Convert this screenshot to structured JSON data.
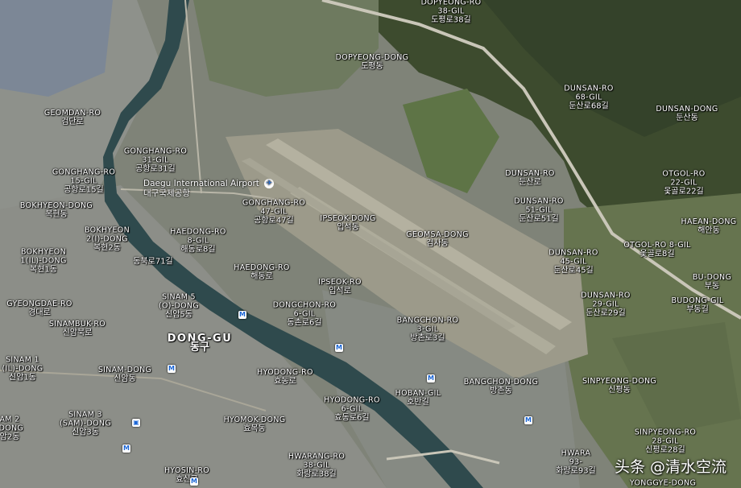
{
  "map": {
    "colors": {
      "urban": "#8a8d86",
      "river": "#2e4a4c",
      "forest": "#3b4a2c",
      "runway": "#9a9886",
      "field": "#6c7b55"
    },
    "airport": {
      "en": "Daegu International Airport",
      "ko": "대구국제공항",
      "icon": "airplane-icon"
    },
    "watermark": "头条 @清水空流",
    "labels": [
      {
        "id": "dopyeong-ro-38-gil",
        "en": "DOPYEONG-RO 38-GIL",
        "en1": "DOPYEONG-RO",
        "en2": "38-GIL",
        "ko": "도평로38길"
      },
      {
        "id": "dopyeong-dong",
        "en": "DOPYEONG-DONG",
        "ko": "도평동"
      },
      {
        "id": "geomdan-ro",
        "en": "GEOMDAN-RO",
        "ko": "검단로"
      },
      {
        "id": "dunsan-ro-68-gil",
        "en1": "DUNSAN-RO",
        "en2": "68-GIL",
        "ko": "둔산로68길"
      },
      {
        "id": "dunsan-dong",
        "en": "DUNSAN-DONG",
        "ko": "둔산동"
      },
      {
        "id": "gonghang-ro-31-gil",
        "en1": "GONGHANG-RO",
        "en2": "31-GIL",
        "ko": "공항로31길"
      },
      {
        "id": "gonghang-ro-15-gil",
        "en1": "GONGHANG-RO",
        "en2": "15-GIL",
        "ko": "공항로15길"
      },
      {
        "id": "bokhyeon-dong",
        "en": "BOKHYEON-DONG",
        "ko": "복현동"
      },
      {
        "id": "gonghang-ro-47-gil",
        "en1": "GONGHANG-RO",
        "en2": "47-GIL",
        "ko": "공항로47길"
      },
      {
        "id": "dunsan-ro",
        "en": "DUNSAN-RO",
        "ko": "둔산로"
      },
      {
        "id": "otgol-ro-22-gil",
        "en1": "OTGOL-RO",
        "en2": "22-GIL",
        "ko": "옻골로22길"
      },
      {
        "id": "dunsan-ro-51-gil",
        "en1": "DUNSAN-RO",
        "en2": "51-GIL",
        "ko": "둔산로51길"
      },
      {
        "id": "bokhyeon-2-dong",
        "en1": "BOKHYEON",
        "en2": "2(I)-DONG",
        "ko": "복현2동"
      },
      {
        "id": "haedong-ro-8-gil",
        "en1": "HAEDONG-RO",
        "en2": "8-GIL",
        "ko": "해동로8길"
      },
      {
        "id": "ipseok-dong",
        "en": "IPSEOK-DONG",
        "ko": "입석동"
      },
      {
        "id": "haean-dong",
        "en": "HAEAN-DONG",
        "ko": "해안동"
      },
      {
        "id": "geomsa-dong",
        "en": "GEOMSA-DONG",
        "ko": "검사동"
      },
      {
        "id": "otgol-ro-8-gil",
        "en": "OTGOL-RO 8-GIL",
        "ko": "옻골로8길"
      },
      {
        "id": "bokhyeon-1-dong",
        "en1": "BOKHYEON",
        "en2": "1(IL)-DONG",
        "ko": "복현1동"
      },
      {
        "id": "dongbungno-71-gil",
        "ko": "동북로71길"
      },
      {
        "id": "dunsan-ro-45-gil",
        "en1": "DUNSAN-RO",
        "en2": "45-GIL",
        "ko": "둔산로45길"
      },
      {
        "id": "haedong-ro",
        "en": "HAEDONG-RO",
        "ko": "해동로"
      },
      {
        "id": "bu-dong",
        "en": "BU-DONG",
        "ko": "부동"
      },
      {
        "id": "ipseok-ro",
        "en": "IPSEOK-RO",
        "ko": "입석로"
      },
      {
        "id": "gyeongdae-ro",
        "en": "GYEONGDAE-RO",
        "ko": "경대로"
      },
      {
        "id": "sinam-5-dong",
        "en1": "SINAM 5",
        "en2": "(O)-DONG",
        "ko": "신암5동"
      },
      {
        "id": "dongchon-ro-6-gil",
        "en1": "DONGCHON-RO",
        "en2": "6-GIL",
        "ko": "동촌로6길"
      },
      {
        "id": "dunsan-ro-29-gil",
        "en1": "DUNSAN-RO",
        "en2": "29-GIL",
        "ko": "둔산로29길"
      },
      {
        "id": "budong-gil",
        "en": "BUDONG-GIL",
        "ko": "부동길"
      },
      {
        "id": "sinambuk-ro",
        "en": "SINAMBUK-RO",
        "ko": "신암북로"
      },
      {
        "id": "bangchon-ro-3-gil",
        "en1": "BANGCHON-RO",
        "en2": "3-GIL",
        "ko": "방촌로3길"
      },
      {
        "id": "dong-gu",
        "en": "DONG-GU",
        "ko": "동구",
        "big": true
      },
      {
        "id": "sinam-1-dong",
        "en1": "SINAM 1",
        "en2": "(IL)-DONG",
        "ko": "신암1동"
      },
      {
        "id": "sinam-dong",
        "en": "SINAM-DONG",
        "ko": "신암동"
      },
      {
        "id": "hyodong-ro",
        "en": "HYODONG-RO",
        "ko": "효동로"
      },
      {
        "id": "sinpyeong-dong",
        "en": "SINPYEONG-DONG",
        "ko": "신평동"
      },
      {
        "id": "bangchon-dong",
        "en": "BANGCHON-DONG",
        "ko": "방촌동"
      },
      {
        "id": "hoban-gil",
        "en": "HOBAN-GIL",
        "ko": "호반길"
      },
      {
        "id": "hyodong-ro-6-gil",
        "en1": "HYODONG-RO",
        "en2": "6-GIL",
        "ko": "효동로6길"
      },
      {
        "id": "sinam-2-dong",
        "en1": "AM 2",
        "en2": "-DONG",
        "ko": "암2동"
      },
      {
        "id": "sinam-3-dong",
        "en1": "SINAM 3",
        "en2": "(SAM)-DONG",
        "ko": "신암3동"
      },
      {
        "id": "hyomok-dong",
        "en": "HYOMOK-DONG",
        "ko": "효목동"
      },
      {
        "id": "sinpyeong-ro-28-gil",
        "en1": "SINPYEONG-RO",
        "en2": "28-GIL",
        "ko": "신평로28길"
      },
      {
        "id": "hwarang-ro-38-gil",
        "en1": "HWARANG-RO",
        "en2": "38-GIL",
        "ko": "화랑로38길"
      },
      {
        "id": "hwarang-ro-93-gil",
        "en1": "HWARA",
        "en2": "93-",
        "ko": "화랑로93길"
      },
      {
        "id": "hyosin-ro",
        "en": "HYOSIN-RO",
        "ko": "효신로"
      },
      {
        "id": "yonggye-dong",
        "en": "YONGGYE-DONG"
      }
    ]
  }
}
